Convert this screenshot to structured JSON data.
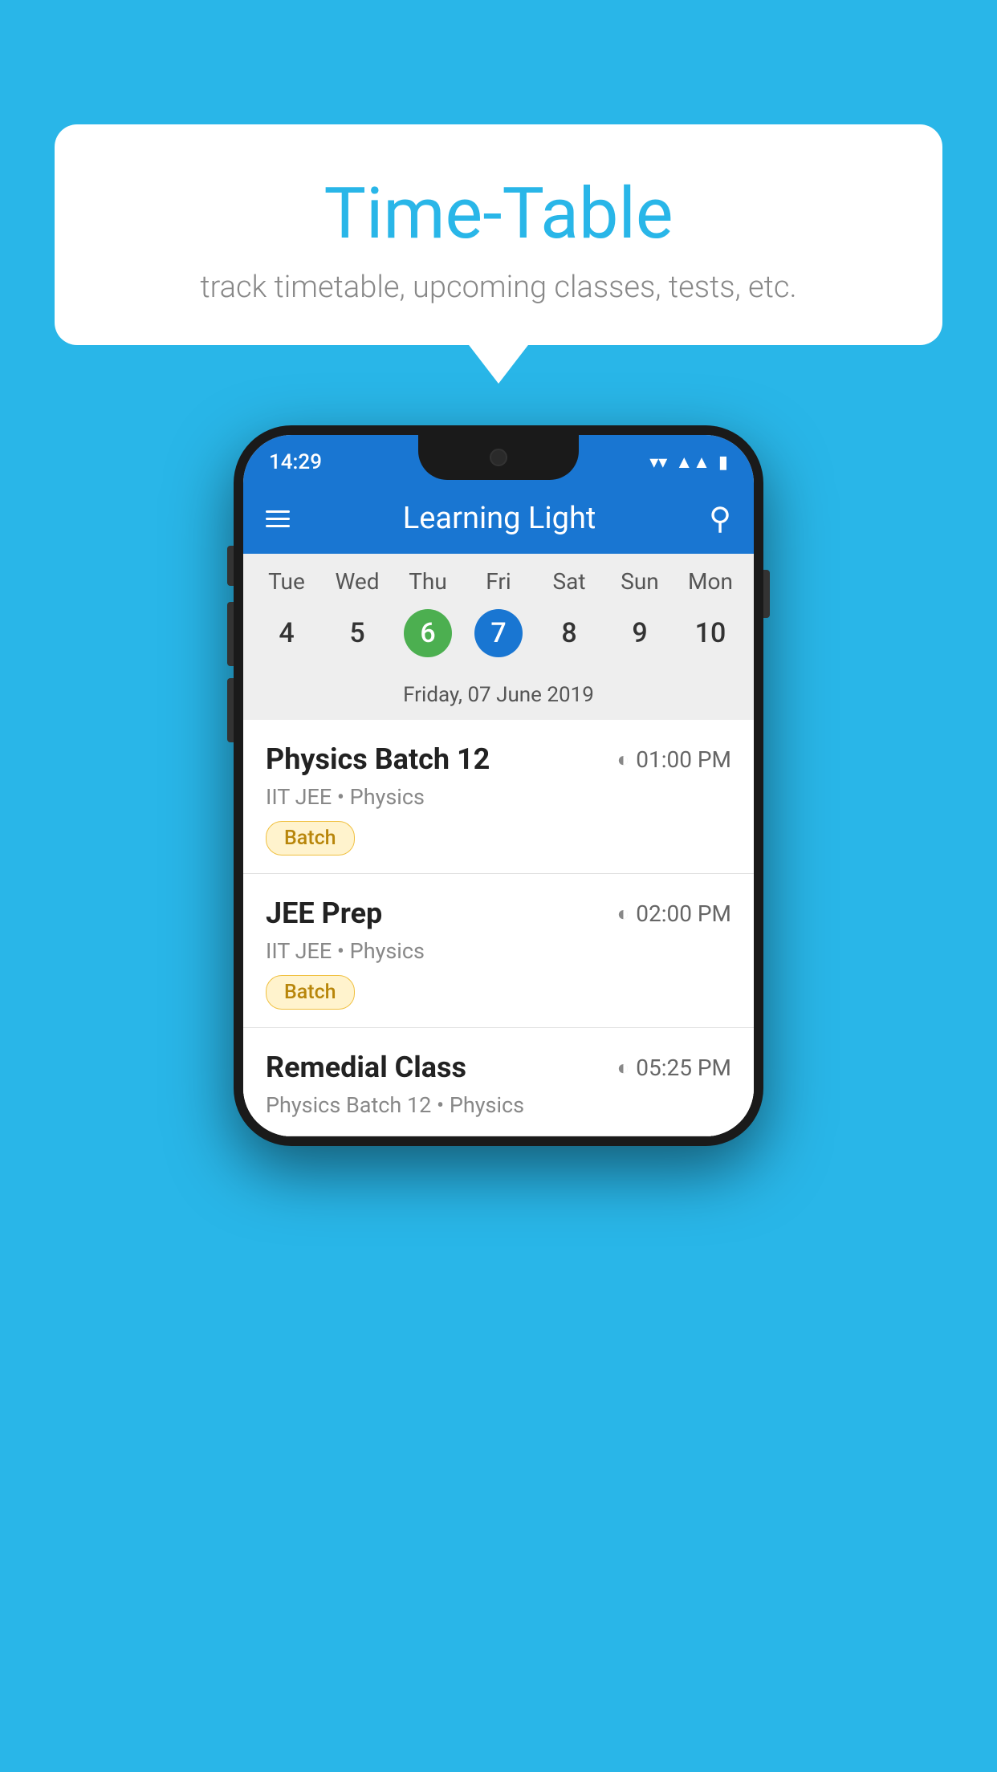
{
  "background_color": "#29b6e8",
  "speech_bubble": {
    "title": "Time-Table",
    "subtitle": "track timetable, upcoming classes, tests, etc."
  },
  "app": {
    "name": "Learning Light",
    "status_bar": {
      "time": "14:29"
    }
  },
  "calendar": {
    "selected_date_label": "Friday, 07 June 2019",
    "days": [
      "Tue",
      "Wed",
      "Thu",
      "Fri",
      "Sat",
      "Sun",
      "Mon"
    ],
    "dates": [
      {
        "number": "4",
        "state": "normal"
      },
      {
        "number": "5",
        "state": "normal"
      },
      {
        "number": "6",
        "state": "today"
      },
      {
        "number": "7",
        "state": "selected"
      },
      {
        "number": "8",
        "state": "normal"
      },
      {
        "number": "9",
        "state": "normal"
      },
      {
        "number": "10",
        "state": "normal"
      }
    ]
  },
  "schedule": {
    "items": [
      {
        "title": "Physics Batch 12",
        "time": "01:00 PM",
        "subtitle": "IIT JEE • Physics",
        "badge": "Batch"
      },
      {
        "title": "JEE Prep",
        "time": "02:00 PM",
        "subtitle": "IIT JEE • Physics",
        "badge": "Batch"
      },
      {
        "title": "Remedial Class",
        "time": "05:25 PM",
        "subtitle": "Physics Batch 12 • Physics",
        "badge": ""
      }
    ]
  },
  "icons": {
    "menu": "☰",
    "search": "🔍",
    "clock": "🕐"
  }
}
